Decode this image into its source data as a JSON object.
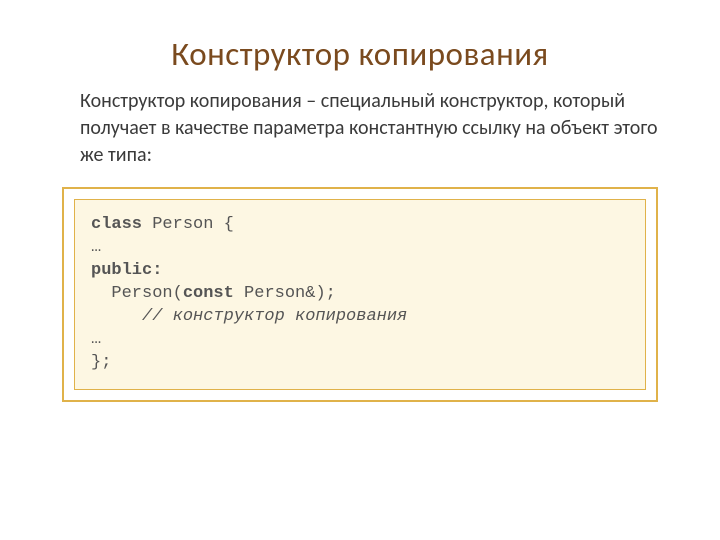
{
  "title": "Конструктор копирования",
  "body": "Конструктор копирования – специальный конструктор, который получает в качестве параметра константную ссылку на объект этого же типа:",
  "code": {
    "l1_kw": "class",
    "l1_rest": " Person {",
    "l2": "…",
    "l3": "public:",
    "l4_a": "  Person(",
    "l4_kw": "const",
    "l4_b": " Person&);",
    "l5": "     // конструктор копирования",
    "l6": "…",
    "l7": "};"
  }
}
